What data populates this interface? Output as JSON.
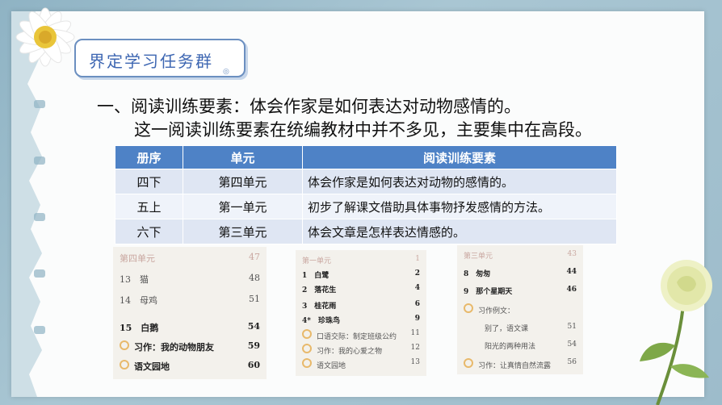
{
  "slide": {
    "tag_title": "界定学习任务群",
    "line1": "一、阅读训练要素：体会作家是如何表达对动物感情的。",
    "line2": "这一阅读训练要素在统编教材中并不多见，主要集中在高段。"
  },
  "table": {
    "headers": [
      "册序",
      "单元",
      "阅读训练要素"
    ],
    "rows": [
      {
        "book": "四下",
        "unit": "第四单元",
        "element": "体会作家是如何表达对动物的感情的。"
      },
      {
        "book": "五上",
        "unit": "第一单元",
        "element": "初步了解课文借助具体事物抒发感情的方法。"
      },
      {
        "book": "六下",
        "unit": "第三单元",
        "element": "体会文章是怎样表达情感的。"
      }
    ]
  },
  "toc1": {
    "head": "第四单元",
    "head_pg": "47",
    "items": [
      {
        "text": "13　猫",
        "pg": "48"
      },
      {
        "text": "14　母鸡",
        "pg": "51"
      },
      {
        "text": "15　白鹅",
        "pg": "54"
      },
      {
        "text": "习作：我的动物朋友",
        "pg": "59"
      },
      {
        "text": "语文园地",
        "pg": "60"
      }
    ]
  },
  "toc2": {
    "head": "第一单元",
    "head_pg": "1",
    "items": [
      {
        "text": "1　白鹭",
        "pg": "2"
      },
      {
        "text": "2　落花生",
        "pg": "4"
      },
      {
        "text": "3　桂花雨",
        "pg": "6"
      },
      {
        "text": "4*　珍珠鸟",
        "pg": "9"
      },
      {
        "text": "口语交际：制定班级公约",
        "pg": "11"
      },
      {
        "text": "习作：我的心爱之物",
        "pg": "12"
      },
      {
        "text": "语文园地",
        "pg": "13"
      }
    ]
  },
  "toc3": {
    "head": "第三单元",
    "head_pg": "43",
    "items": [
      {
        "text": "8　匆匆",
        "pg": "44"
      },
      {
        "text": "9　那个星期天",
        "pg": "46"
      },
      {
        "text": "习作例文：",
        "pg": ""
      },
      {
        "text": "别了，语文课",
        "pg": "51"
      },
      {
        "text": "阳光的两种用法",
        "pg": "54"
      },
      {
        "text": "习作：让真情自然流露",
        "pg": "56"
      }
    ]
  },
  "colors": {
    "accent": "#4e82c6",
    "tag_text": "#3d66b2",
    "background": "#9dbccb"
  },
  "icons": [
    "daisy-flower-icon",
    "rose-flower-icon"
  ]
}
